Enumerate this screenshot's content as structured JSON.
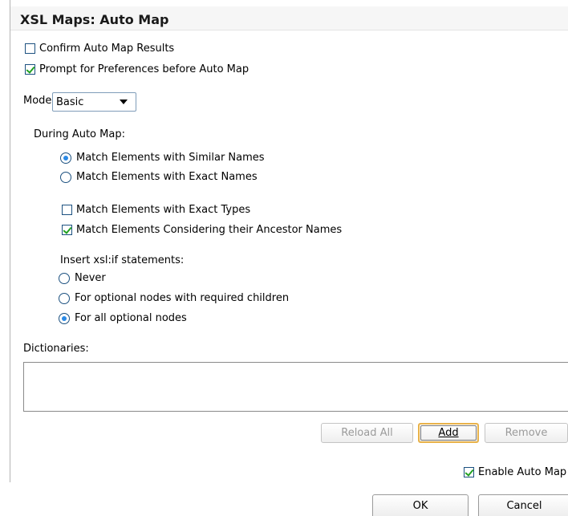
{
  "header": {
    "title": "XSL Maps: Auto Map"
  },
  "options": {
    "confirm_auto_map_results": {
      "label": "Confirm Auto Map Results",
      "checked": false
    },
    "prompt_for_preferences": {
      "label": "Prompt for Preferences before Auto Map",
      "checked": true
    }
  },
  "mode": {
    "label": "Mode:",
    "value": "Basic"
  },
  "during_auto_map": {
    "label": "During Auto Map:",
    "match_similar": {
      "label": "Match Elements with Similar Names",
      "selected": true
    },
    "match_exact": {
      "label": "Match Elements with Exact Names",
      "selected": false
    },
    "match_exact_types": {
      "label": "Match Elements with Exact Types",
      "checked": false
    },
    "match_ancestor": {
      "label": "Match Elements Considering their Ancestor Names",
      "checked": true
    }
  },
  "xslif": {
    "label": "Insert xsl:if statements:",
    "never": {
      "label": "Never",
      "selected": false
    },
    "optional_required_children": {
      "label": "For optional nodes with required children",
      "selected": false
    },
    "all_optional": {
      "label": "For all optional nodes",
      "selected": true
    }
  },
  "dictionaries": {
    "label": "Dictionaries:",
    "reload_all": "Reload All",
    "add": "Add",
    "remove": "Remove"
  },
  "footer": {
    "enable_auto_map": {
      "label": "Enable Auto Map",
      "checked": true
    },
    "ok": "OK",
    "cancel": "Cancel"
  },
  "colors": {
    "checkbox_border": "#1c5180",
    "checkmark": "#21a121",
    "radio_dot": "#2b8ae6",
    "default_button_ring": "#e8b24a"
  }
}
